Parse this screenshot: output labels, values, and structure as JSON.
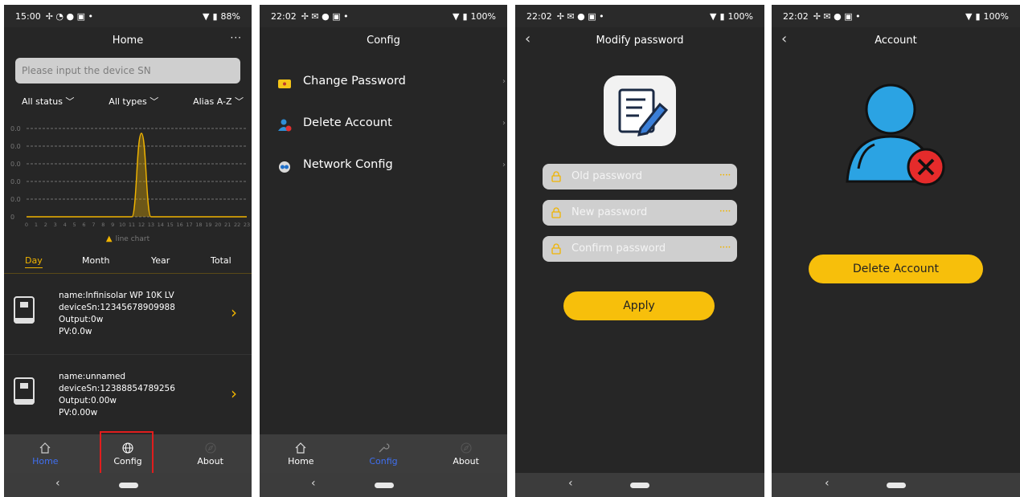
{
  "colors": {
    "accent": "#f0b400",
    "button": "#f7bf0b",
    "active_tab": "#3f6ff0",
    "background": "#262626"
  },
  "panel1": {
    "status": {
      "time": "15:00",
      "battery": "88%"
    },
    "title": "Home",
    "more": "···",
    "search_placeholder": "Please input the device SN",
    "filters": [
      "All status",
      "All types",
      "Alias A-Z"
    ],
    "legend": "line chart",
    "periods": [
      "Day",
      "Month",
      "Year",
      "Total"
    ],
    "active_period": "Day",
    "devices": [
      {
        "name": "name:Infinisolar WP 10K LV",
        "sn": "deviceSn:12345678909988",
        "output": "Output:0w",
        "pv": "PV:0.0w"
      },
      {
        "name": "name:unnamed",
        "sn": "deviceSn:12388854789256",
        "output": "Output:0.00w",
        "pv": "PV:0.00w"
      }
    ],
    "tabs": [
      "Home",
      "Config",
      "About"
    ],
    "active_tab": "Home"
  },
  "chart_data": {
    "type": "line",
    "x": [
      "0",
      "1",
      "2",
      "3",
      "4",
      "5",
      "6",
      "7",
      "8",
      "9",
      "10",
      "11",
      "12",
      "13",
      "14",
      "15",
      "16",
      "17",
      "18",
      "19",
      "20",
      "21",
      "22",
      "23"
    ],
    "y_tick_labels": [
      "0.0",
      "0.0",
      "0.0",
      "0.0",
      "0.0",
      "0"
    ],
    "series": [
      {
        "name": "line chart",
        "values": [
          0,
          0,
          0,
          0,
          0,
          0,
          0,
          0,
          0,
          0,
          0,
          0,
          0.5,
          0,
          0,
          0,
          0,
          0,
          0,
          0,
          0,
          0,
          0,
          0
        ]
      }
    ],
    "grid": true,
    "legend_position": "bottom"
  },
  "panel2": {
    "status": {
      "time": "22:02",
      "battery": "100%"
    },
    "title": "Config",
    "menu": [
      "Change Password",
      "Delete Account",
      "Network Config"
    ],
    "tabs": [
      "Home",
      "Config",
      "About"
    ],
    "active_tab": "Config"
  },
  "panel3": {
    "status": {
      "time": "22:02",
      "battery": "100%"
    },
    "title": "Modify password",
    "fields": [
      "Old password",
      "New password",
      "Confirm password"
    ],
    "apply": "Apply"
  },
  "panel4": {
    "status": {
      "time": "22:02",
      "battery": "100%"
    },
    "title": "Account",
    "delete": "Delete Account"
  }
}
